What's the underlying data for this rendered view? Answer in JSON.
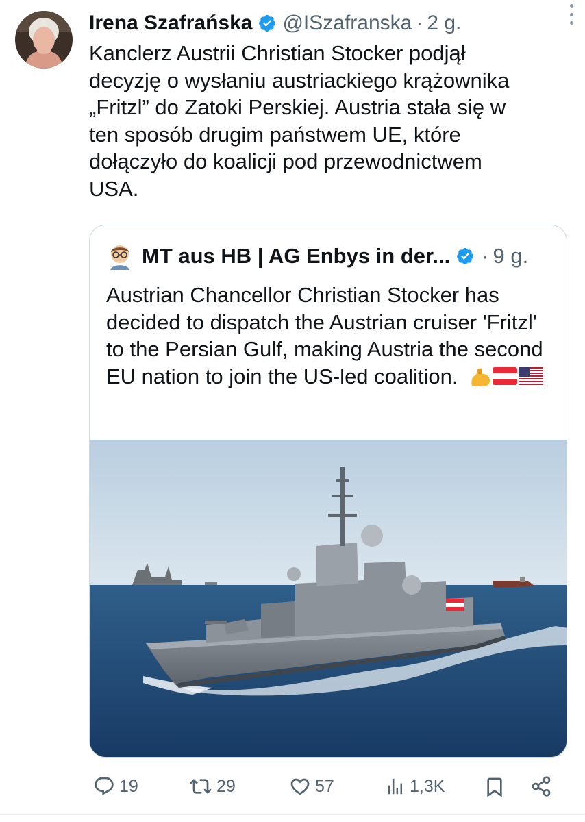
{
  "tweet": {
    "author_name": "Irena Szafrańska",
    "handle": "@ISzafranska",
    "separator": "·",
    "time": "2 g.",
    "text": "Kanclerz Austrii Christian Stocker podjął\ndecyzję o wysłaniu austriackiego krążownika\n„Fritzl” do Zatoki Perskiej. Austria stała się w\nten sposób drugim państwem UE, które\ndołączyło do koalicji pod przewodnictwem\nUSA."
  },
  "quote": {
    "author_name": "MT aus HB | AG Enbys in der...",
    "separator": "·",
    "time": "9 g.",
    "text": "Austrian Chancellor Christian Stocker has decided to dispatch the Austrian cruiser 'Fritzl' to the Persian Gulf, making Austria the second EU nation to join the US-led coalition."
  },
  "actions": {
    "replies": "19",
    "reposts": "29",
    "likes": "57",
    "views": "1,3K"
  },
  "colors": {
    "text": "#0f1419",
    "secondary": "#536471",
    "verified": "#1d9bf0",
    "border": "#cfd9de"
  },
  "icons": [
    "more-icon",
    "verified-badge-icon",
    "reply-icon",
    "repost-icon",
    "like-icon",
    "views-icon",
    "bookmark-icon",
    "share-icon"
  ]
}
